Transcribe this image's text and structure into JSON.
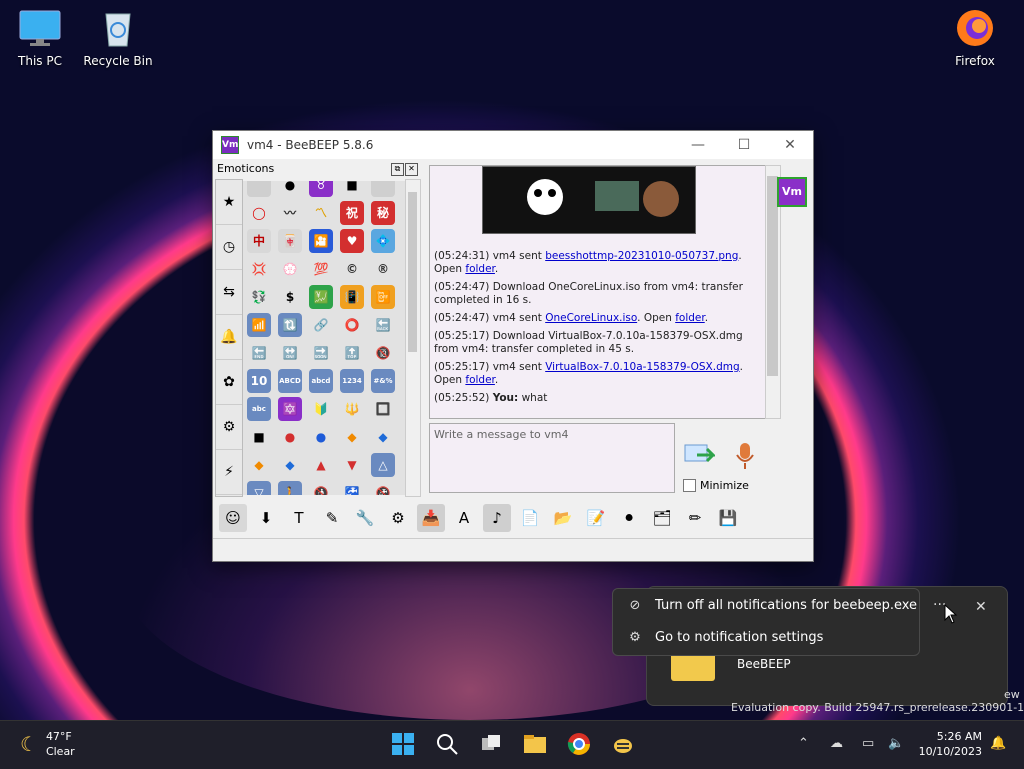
{
  "desktop": {
    "icons": [
      {
        "label": "This PC",
        "icon": "monitor-icon"
      },
      {
        "label": "Recycle Bin",
        "icon": "recycle-bin-icon"
      },
      {
        "label": "Firefox",
        "icon": "firefox-icon"
      }
    ]
  },
  "window": {
    "title": "vm4 - BeeBEEP 5.8.6",
    "app_icon_text": "Vm",
    "controls": {
      "minimize": "—",
      "maximize": "☐",
      "close": "✕"
    },
    "emoticons_panel": {
      "title": "Emoticons",
      "float_btn": "⧉",
      "close_btn": "✕",
      "tabs": [
        "★",
        "◷",
        "⇆",
        "🔔",
        "✿",
        "⚙",
        "⚡"
      ],
      "cells": [
        {
          "g": "",
          "bg": "#cfcfcf",
          "c": "#000"
        },
        {
          "g": "●",
          "bg": "#e2e2e2",
          "c": "#000"
        },
        {
          "g": "♉",
          "bg": "#8a2fc8",
          "c": "#fff"
        },
        {
          "g": "■",
          "bg": "#e2e2e2",
          "c": "#000"
        },
        {
          "g": "",
          "bg": "#cfcfcf",
          "c": "#000"
        },
        {
          "g": "◯",
          "bg": "#e2e2e2",
          "c": "#d00"
        },
        {
          "g": "〰",
          "bg": "#e2e2e2",
          "c": "#333"
        },
        {
          "g": "〽",
          "bg": "#e2e2e2",
          "c": "#e0a000"
        },
        {
          "g": "祝",
          "bg": "#d32f2f",
          "c": "#fff"
        },
        {
          "g": "秘",
          "bg": "#d32f2f",
          "c": "#fff"
        },
        {
          "g": "中",
          "bg": "#d8d8d8",
          "c": "#b00"
        },
        {
          "g": "🀄",
          "bg": "#d8d8d8",
          "c": "#333"
        },
        {
          "g": "🎦",
          "bg": "#2a5bd8",
          "c": "#fff"
        },
        {
          "g": "♥",
          "bg": "#d32f2f",
          "c": "#fff"
        },
        {
          "g": "💠",
          "bg": "#5aa7e0",
          "c": "#fff"
        },
        {
          "g": "💢",
          "bg": "#e2e2e2",
          "c": "#d00"
        },
        {
          "g": "💮",
          "bg": "#e2e2e2",
          "c": "#d66"
        },
        {
          "g": "💯",
          "bg": "#e2e2e2",
          "c": "#d00"
        },
        {
          "g": "©",
          "bg": "#e2e2e2",
          "c": "#333"
        },
        {
          "g": "®",
          "bg": "#e2e2e2",
          "c": "#333"
        },
        {
          "g": "💱",
          "bg": "#e2e2e2",
          "c": "#333"
        },
        {
          "g": "$",
          "bg": "#e2e2e2",
          "c": "#000"
        },
        {
          "g": "💹",
          "bg": "#2ea34a",
          "c": "#fff"
        },
        {
          "g": "📳",
          "bg": "#f0a020",
          "c": "#fff"
        },
        {
          "g": "📴",
          "bg": "#f0a020",
          "c": "#fff"
        },
        {
          "g": "📶",
          "bg": "#6a8ac0",
          "c": "#fff"
        },
        {
          "g": "🔃",
          "bg": "#6a8ac0",
          "c": "#fff"
        },
        {
          "g": "🔗",
          "bg": "#e2e2e2",
          "c": "#555"
        },
        {
          "g": "⭕",
          "bg": "#e2e2e2",
          "c": "#555"
        },
        {
          "g": "🔙",
          "bg": "#e2e2e2",
          "c": "#000"
        },
        {
          "g": "🔚",
          "bg": "#e2e2e2",
          "c": "#555"
        },
        {
          "g": "🔛",
          "bg": "#e2e2e2",
          "c": "#555"
        },
        {
          "g": "🔜",
          "bg": "#e2e2e2",
          "c": "#555"
        },
        {
          "g": "🔝",
          "bg": "#e2e2e2",
          "c": "#555"
        },
        {
          "g": "🔞",
          "bg": "#e2e2e2",
          "c": "#d00"
        },
        {
          "g": "10",
          "bg": "#6a8ac0",
          "c": "#fff"
        },
        {
          "g": "ABCD",
          "bg": "#6a8ac0",
          "c": "#fff"
        },
        {
          "g": "abcd",
          "bg": "#6a8ac0",
          "c": "#fff"
        },
        {
          "g": "1234",
          "bg": "#6a8ac0",
          "c": "#fff"
        },
        {
          "g": "#&%",
          "bg": "#6a8ac0",
          "c": "#fff"
        },
        {
          "g": "abc",
          "bg": "#6a8ac0",
          "c": "#fff"
        },
        {
          "g": "🔯",
          "bg": "#8a2fc8",
          "c": "#fff"
        },
        {
          "g": "🔰",
          "bg": "#e2e2e2",
          "c": "#2ea34a"
        },
        {
          "g": "🔱",
          "bg": "#e2e2e2",
          "c": "#c07a00"
        },
        {
          "g": "🔲",
          "bg": "#e2e2e2",
          "c": "#000"
        },
        {
          "g": "■",
          "bg": "#e2e2e2",
          "c": "#000"
        },
        {
          "g": "●",
          "bg": "#e2e2e2",
          "c": "#d32f2f"
        },
        {
          "g": "●",
          "bg": "#e2e2e2",
          "c": "#1e5bd8"
        },
        {
          "g": "◆",
          "bg": "#e2e2e2",
          "c": "#f08a00"
        },
        {
          "g": "◆",
          "bg": "#e2e2e2",
          "c": "#1e6bd8"
        },
        {
          "g": "◆",
          "bg": "#e2e2e2",
          "c": "#f08a00"
        },
        {
          "g": "◆",
          "bg": "#e2e2e2",
          "c": "#1e6bd8"
        },
        {
          "g": "▲",
          "bg": "#e2e2e2",
          "c": "#d32f2f"
        },
        {
          "g": "▼",
          "bg": "#e2e2e2",
          "c": "#d32f2f"
        },
        {
          "g": "△",
          "bg": "#6a8ac0",
          "c": "#fff"
        },
        {
          "g": "▽",
          "bg": "#6a8ac0",
          "c": "#fff"
        },
        {
          "g": "🚶",
          "bg": "#6a8ac0",
          "c": "#fff"
        },
        {
          "g": "🚯",
          "bg": "#e2e2e2",
          "c": "#d00"
        },
        {
          "g": "🚰",
          "bg": "#e2e2e2",
          "c": "#555"
        },
        {
          "g": "🚱",
          "bg": "#e2e2e2",
          "c": "#d00"
        }
      ]
    },
    "chat": {
      "messages": [
        {
          "time": "(05:24:31)",
          "pre": "vm4 sent ",
          "link": "beesshottmp-20231010-050737.png",
          "post": ".",
          "line2": "Open ",
          "link2": "folder",
          "post2": "."
        },
        {
          "time": "(05:24:47)",
          "pre": "Download OneCoreLinux.iso from vm4: transfer completed in 16 s.",
          "link": "",
          "post": "",
          "line2": "",
          "link2": "",
          "post2": ""
        },
        {
          "time": "(05:24:47)",
          "pre": "vm4 sent ",
          "link": "OneCoreLinux.iso",
          "post": ". Open ",
          "line2": "",
          "link2": "folder",
          "post2": "."
        },
        {
          "time": "(05:25:17)",
          "pre": "Download VirtualBox-7.0.10a-158379-OSX.dmg from vm4: transfer completed in 45 s.",
          "link": "",
          "post": "",
          "line2": "",
          "link2": "",
          "post2": ""
        },
        {
          "time": "(05:25:17)",
          "pre": "vm4 sent ",
          "link": "VirtualBox-7.0.10a-158379-OSX.dmg",
          "post": ".",
          "line2": "Open ",
          "link2": "folder",
          "post2": "."
        }
      ],
      "last": {
        "time": "(05:25:52)",
        "who": "You:",
        "text": " what"
      }
    },
    "input": {
      "placeholder": "Write a message to vm4"
    },
    "minimize_label": "Minimize",
    "side_user": "Vm",
    "toolbar": [
      "☺",
      "⬇",
      "T",
      "✎",
      "🔧",
      "⚙",
      "📥",
      "A",
      "♪",
      "📄",
      "📂",
      "📝",
      "⚫",
      "🗂",
      "✏",
      "💾"
    ]
  },
  "notification": {
    "menu": [
      {
        "icon": "⊘",
        "label": "Turn off all notifications for beebeep.exe"
      },
      {
        "icon": "⚙",
        "label": "Go to notification settings"
      }
    ],
    "more": "···",
    "close": "✕",
    "app_name": "BeeBEEP"
  },
  "watermark": {
    "line1": "ew",
    "line2": "Evaluation copy. Build 25947.rs_prerelease.230901-1416"
  },
  "taskbar": {
    "weather": {
      "temp": "47°F",
      "cond": "Clear"
    },
    "time": "5:26 AM",
    "date": "10/10/2023"
  }
}
